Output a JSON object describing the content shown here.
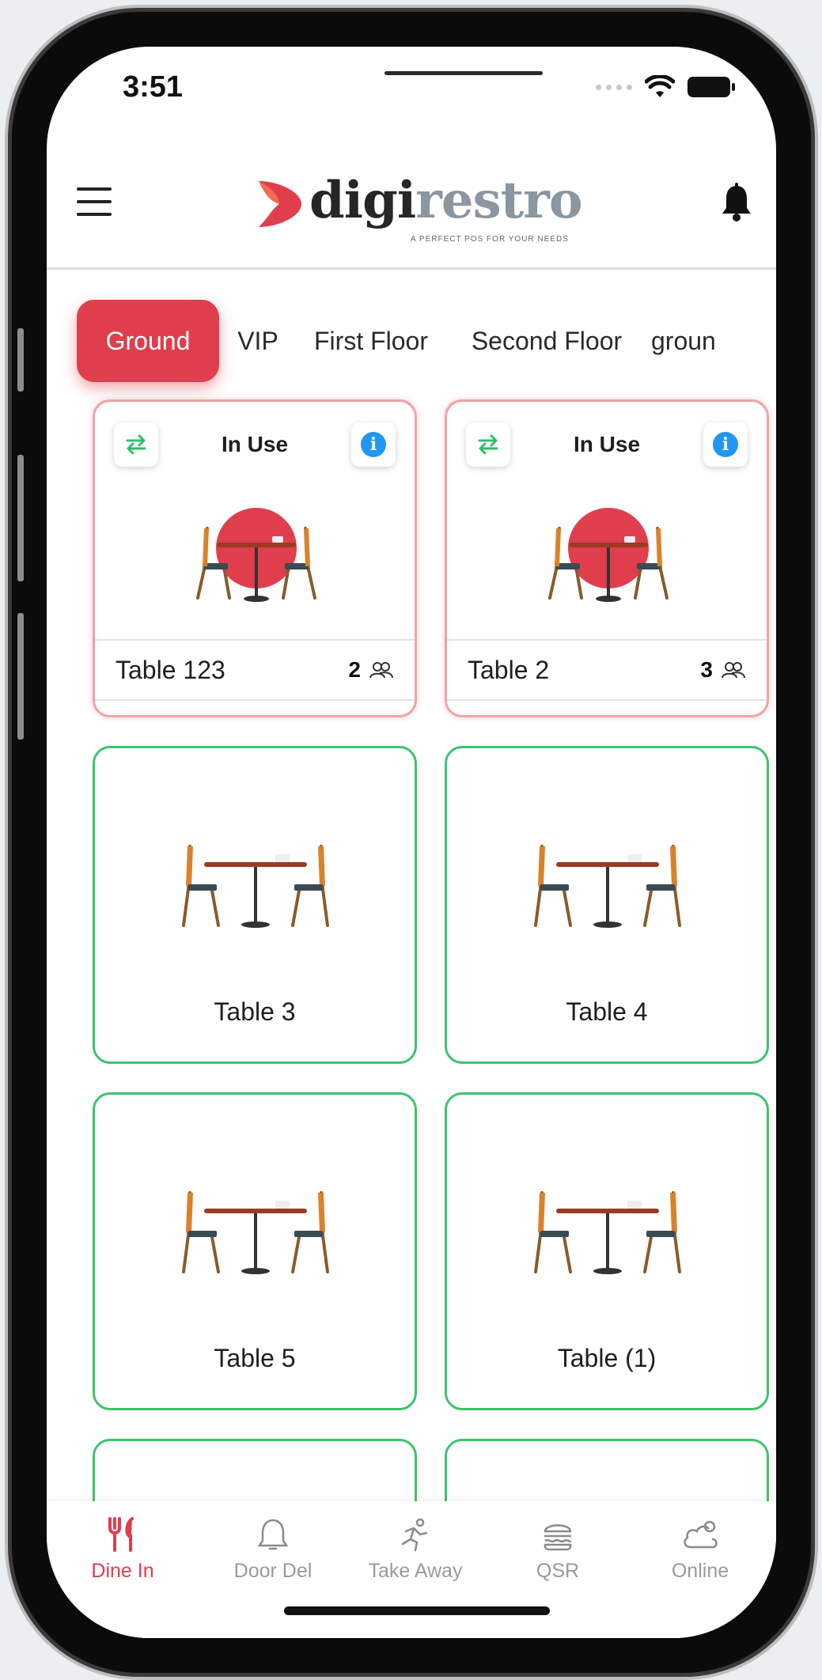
{
  "status_bar": {
    "time": "3:51"
  },
  "header": {
    "logo_part1": "digi",
    "logo_part2": "restro",
    "tagline": "A PERFECT POS FOR YOUR NEEDS",
    "brand_color": "#e03e4d"
  },
  "floors": {
    "active_index": 0,
    "tabs": [
      "Ground",
      "VIP",
      "First Floor",
      "Second Floor",
      "groun"
    ]
  },
  "tables": [
    {
      "name": "Table 123",
      "status": "In Use",
      "guests": "2"
    },
    {
      "name": "Table 2",
      "status": "In Use",
      "guests": "3"
    },
    {
      "name": "Table 3",
      "status": ""
    },
    {
      "name": "Table 4",
      "status": ""
    },
    {
      "name": "Table 5",
      "status": ""
    },
    {
      "name": "Table (1)",
      "status": ""
    }
  ],
  "colors": {
    "in_use_border": "#f1a3a6",
    "available_border": "#3ec36c",
    "in_use_circle": "#e03e4d",
    "info": "#2196f3"
  },
  "bottom_nav": {
    "active": "Dine In",
    "items": [
      {
        "label": "Dine In",
        "icon": "fork-knife-icon"
      },
      {
        "label": "Door Del",
        "icon": "bell-icon"
      },
      {
        "label": "Take Away",
        "icon": "running-person-icon"
      },
      {
        "label": "QSR",
        "icon": "burger-icon"
      },
      {
        "label": "Online",
        "icon": "cloud-user-icon"
      }
    ]
  }
}
